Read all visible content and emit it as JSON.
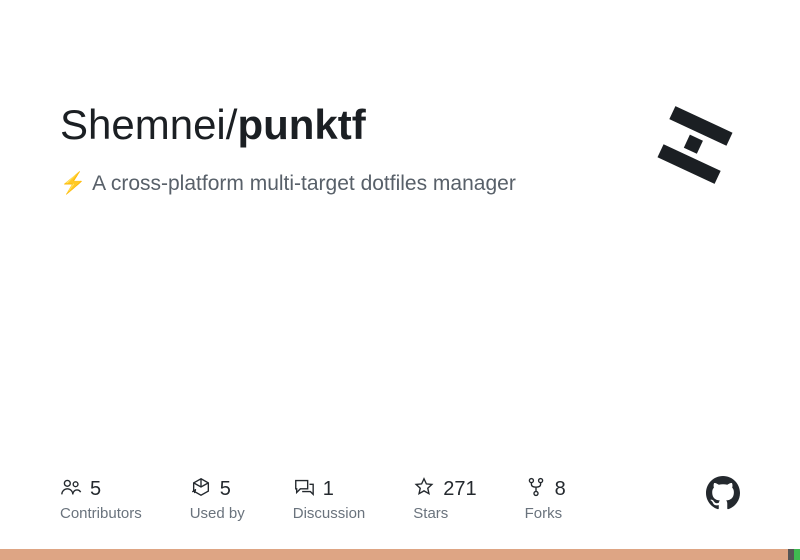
{
  "repo": {
    "owner": "Shemnei",
    "slash": "/",
    "name": "punktf"
  },
  "description": {
    "emoji": "⚡",
    "text": "A cross-platform multi-target dotfiles manager"
  },
  "stats": {
    "contributors": {
      "count": "5",
      "label": "Contributors"
    },
    "usedby": {
      "count": "5",
      "label": "Used by"
    },
    "discussion": {
      "count": "1",
      "label": "Discussion"
    },
    "stars": {
      "count": "271",
      "label": "Stars"
    },
    "forks": {
      "count": "8",
      "label": "Forks"
    }
  },
  "languages": [
    {
      "color": "#dea584",
      "percent": 98.5
    },
    {
      "color": "#555555",
      "percent": 0.7
    },
    {
      "color": "#3fb950",
      "percent": 0.8
    }
  ]
}
